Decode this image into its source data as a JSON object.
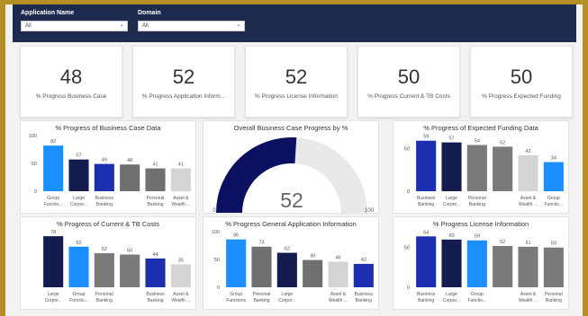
{
  "filters": [
    {
      "label": "Application Name",
      "value": "All"
    },
    {
      "label": "Domain",
      "value": "All"
    }
  ],
  "kpis": [
    {
      "value": "48",
      "label": "% Progress Business Case"
    },
    {
      "value": "52",
      "label": "% Progress Application Inform..."
    },
    {
      "value": "52",
      "label": "% Progress License Information"
    },
    {
      "value": "50",
      "label": "% Progress Current & TB Costs"
    },
    {
      "value": "50",
      "label": "% Progress Expected Funding"
    }
  ],
  "gauge": {
    "title": "Overall Business Case Progress by %",
    "value": 52,
    "min_label": "0",
    "max_label": "100",
    "max": 100,
    "colors": {
      "fill": "#0b1160",
      "track": "#e9e9e9"
    }
  },
  "chart_data": [
    {
      "type": "bar",
      "title": "% Progress of Business Case Data",
      "categories": [
        [
          "Group",
          "Functio..."
        ],
        [
          "Large",
          "Corpor..."
        ],
        [
          "Business",
          "Banking"
        ],
        [
          "",
          ""
        ],
        [
          "Personal",
          "Banking"
        ],
        [
          "Asset &",
          "Wealth ..."
        ]
      ],
      "values": [
        82,
        57,
        49,
        48,
        41,
        41
      ],
      "colors": [
        "#1a8fff",
        "#141c4f",
        "#1c2fb0",
        "#707070",
        "#707070",
        "#d4d4d4"
      ],
      "yticks": [
        "0",
        "50",
        "100"
      ],
      "ylim": [
        0,
        100
      ]
    },
    {
      "type": "bar",
      "title": "% Progress of Expected Funding Data",
      "categories": [
        [
          "Business",
          "Banking"
        ],
        [
          "Large",
          "Corpor..."
        ],
        [
          "Personal",
          "Banking"
        ],
        [
          "",
          ""
        ],
        [
          "Asset &",
          "Wealth ..."
        ],
        [
          "Group",
          "Functio..."
        ]
      ],
      "values": [
        59,
        57,
        54,
        52,
        42,
        34
      ],
      "colors": [
        "#1c2fb0",
        "#141c4f",
        "#7a7a7a",
        "#7a7a7a",
        "#d4d4d4",
        "#1a8fff"
      ],
      "yticks": [
        "0",
        "50"
      ],
      "ylim": [
        0,
        65
      ]
    },
    {
      "type": "bar",
      "title": "% Progress of Current & TB Costs",
      "categories": [
        [
          "Large",
          "Corpor..."
        ],
        [
          "Group",
          "Functio..."
        ],
        [
          "Personal",
          "Banking"
        ],
        [
          "",
          ""
        ],
        [
          "Business",
          "Banking"
        ],
        [
          "Asset &",
          "Wealth ..."
        ]
      ],
      "values": [
        78,
        62,
        52,
        50,
        44,
        35
      ],
      "colors": [
        "#141c4f",
        "#1a8fff",
        "#7a7a7a",
        "#7a7a7a",
        "#1c2fb0",
        "#d4d4d4"
      ],
      "yticks": [],
      "ylim": [
        0,
        85
      ]
    },
    {
      "type": "bar",
      "title": "% Progress General Application Information",
      "categories": [
        [
          "Group",
          "Functions"
        ],
        [
          "Personal",
          "Banking"
        ],
        [
          "Large",
          "Corpor..."
        ],
        [
          "",
          ""
        ],
        [
          "Asset &",
          "Wealth ..."
        ],
        [
          "Business",
          "Banking"
        ]
      ],
      "values": [
        86,
        73,
        62,
        49,
        46,
        42
      ],
      "colors": [
        "#1a8fff",
        "#707070",
        "#141c4f",
        "#707070",
        "#d4d4d4",
        "#1c2fb0"
      ],
      "yticks": [
        "0",
        "50",
        "100"
      ],
      "ylim": [
        0,
        100
      ]
    },
    {
      "type": "bar",
      "title": "% Progress License Information",
      "categories": [
        [
          "Business",
          "Banking"
        ],
        [
          "Large",
          "Corpor..."
        ],
        [
          "Group",
          "Functio..."
        ],
        [
          "",
          ""
        ],
        [
          "Asset &",
          "Wealth ..."
        ],
        [
          "Personal",
          "Banking"
        ]
      ],
      "values": [
        64,
        60,
        59,
        52,
        51,
        50
      ],
      "colors": [
        "#1c2fb0",
        "#141c4f",
        "#1a8fff",
        "#7a7a7a",
        "#7a7a7a",
        "#7a7a7a"
      ],
      "yticks": [
        "0",
        "50"
      ],
      "ylim": [
        0,
        70
      ]
    }
  ]
}
